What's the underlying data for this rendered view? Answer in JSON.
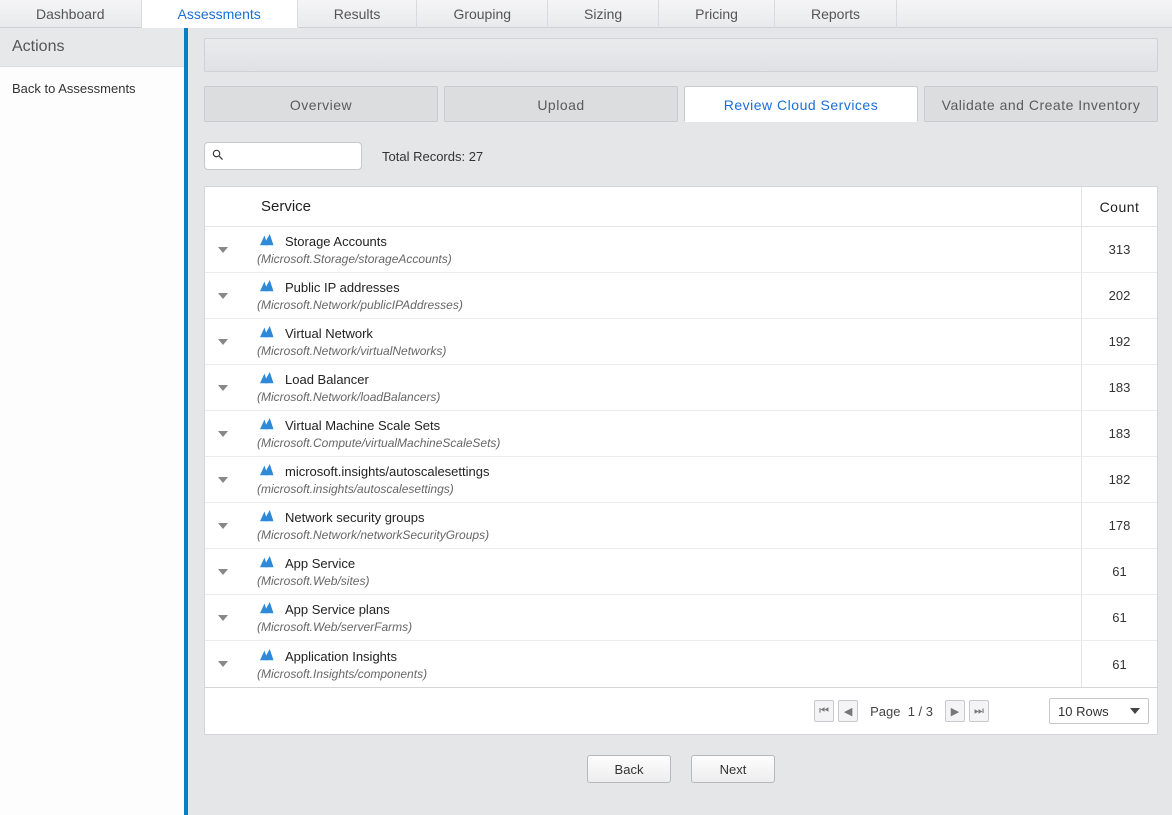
{
  "topTabs": {
    "items": [
      "Dashboard",
      "Assessments",
      "Results",
      "Grouping",
      "Sizing",
      "Pricing",
      "Reports"
    ],
    "activeIndex": 1
  },
  "sidebar": {
    "header": "Actions",
    "back_label": "Back to Assessments"
  },
  "subtabs": {
    "items": [
      "Overview",
      "Upload",
      "Review Cloud Services",
      "Validate and Create Inventory"
    ],
    "activeIndex": 2
  },
  "toolbar": {
    "search_placeholder": "",
    "total_records_label": "Total Records: 27"
  },
  "table": {
    "headers": {
      "service": "Service",
      "count": "Count"
    },
    "rows": [
      {
        "name": "Storage Accounts",
        "sub": "(Microsoft.Storage/storageAccounts)",
        "count": "313"
      },
      {
        "name": "Public IP addresses",
        "sub": "(Microsoft.Network/publicIPAddresses)",
        "count": "202"
      },
      {
        "name": "Virtual Network",
        "sub": "(Microsoft.Network/virtualNetworks)",
        "count": "192"
      },
      {
        "name": "Load Balancer",
        "sub": "(Microsoft.Network/loadBalancers)",
        "count": "183"
      },
      {
        "name": "Virtual Machine Scale Sets",
        "sub": "(Microsoft.Compute/virtualMachineScaleSets)",
        "count": "183"
      },
      {
        "name": "microsoft.insights/autoscalesettings",
        "sub": "(microsoft.insights/autoscalesettings)",
        "count": "182"
      },
      {
        "name": "Network security groups",
        "sub": "(Microsoft.Network/networkSecurityGroups)",
        "count": "178"
      },
      {
        "name": "App Service",
        "sub": "(Microsoft.Web/sites)",
        "count": "61"
      },
      {
        "name": "App Service plans",
        "sub": "(Microsoft.Web/serverFarms)",
        "count": "61"
      },
      {
        "name": "Application Insights",
        "sub": "(Microsoft.Insights/components)",
        "count": "61"
      }
    ]
  },
  "pager": {
    "page_label": "Page",
    "page_value": "1 / 3",
    "rows_label": "10 Rows"
  },
  "footer": {
    "back": "Back",
    "next": "Next"
  },
  "colors": {
    "accent": "#1a6fd6",
    "sidebar_border": "#0a7ec4",
    "azure": "#2e8ad8"
  }
}
